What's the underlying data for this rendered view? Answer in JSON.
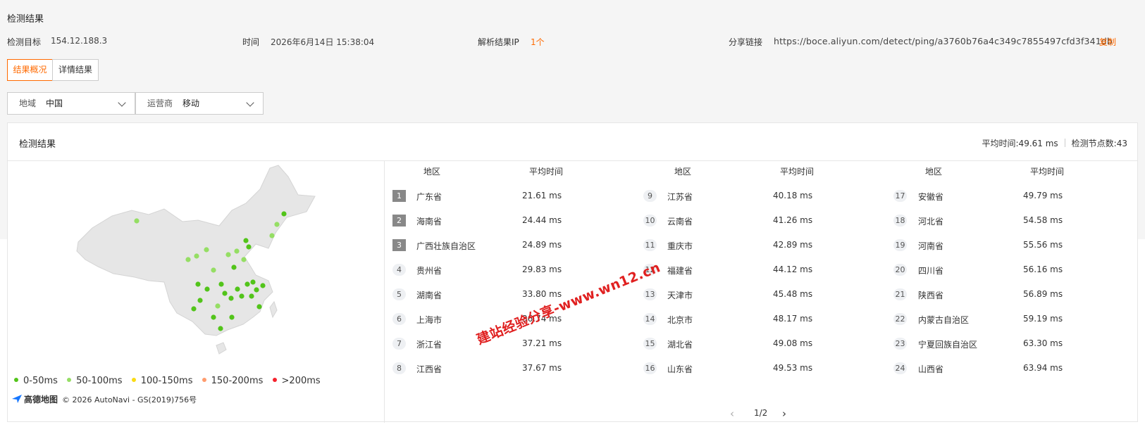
{
  "page": {
    "title": "检测结果"
  },
  "info": {
    "target_label": "检测目标",
    "target_value": "154.12.188.3",
    "time_label": "时间",
    "time_value": "2026年6月14日 15:38:04",
    "ip_label": "解析结果IP",
    "ip_value": "1个",
    "share_label": "分享链接",
    "share_value": "https://boce.aliyun.com/detect/ping/a3760b76a4c349c7855497cfd3f341db",
    "copy_label": "复制"
  },
  "tabs": [
    {
      "label": "结果概况",
      "active": true
    },
    {
      "label": "详情结果",
      "active": false
    }
  ],
  "filters": {
    "region": {
      "label": "地域",
      "value": "中国"
    },
    "isp": {
      "label": "运营商",
      "value": "移动"
    }
  },
  "panel": {
    "title": "检测结果",
    "avg_time": "平均时间:49.61 ms",
    "node_count": "检测节点数:43"
  },
  "legend": [
    {
      "label": "0-50ms",
      "color": "#52c41a"
    },
    {
      "label": "50-100ms",
      "color": "#95de64"
    },
    {
      "label": "100-150ms",
      "color": "#fadb14"
    },
    {
      "label": "150-200ms",
      "color": "#ff9c6e"
    },
    {
      "label": ">200ms",
      "color": "#f5222d"
    }
  ],
  "map_attribution": {
    "brand": "高德地图",
    "copyright": "© 2026 AutoNavi - GS(2019)756号"
  },
  "table": {
    "headers": {
      "region": "地区",
      "avg": "平均时间"
    },
    "rows": [
      {
        "rank": "1",
        "region": "广东省",
        "avg": "21.61 ms"
      },
      {
        "rank": "2",
        "region": "海南省",
        "avg": "24.44 ms"
      },
      {
        "rank": "3",
        "region": "广西壮族自治区",
        "avg": "24.89 ms"
      },
      {
        "rank": "4",
        "region": "贵州省",
        "avg": "29.83 ms"
      },
      {
        "rank": "5",
        "region": "湖南省",
        "avg": "33.80 ms"
      },
      {
        "rank": "6",
        "region": "上海市",
        "avg": "36.74 ms"
      },
      {
        "rank": "7",
        "region": "浙江省",
        "avg": "37.21 ms"
      },
      {
        "rank": "8",
        "region": "江西省",
        "avg": "37.67 ms"
      },
      {
        "rank": "9",
        "region": "江苏省",
        "avg": "40.18 ms"
      },
      {
        "rank": "10",
        "region": "云南省",
        "avg": "41.26 ms"
      },
      {
        "rank": "11",
        "region": "重庆市",
        "avg": "42.89 ms"
      },
      {
        "rank": "12",
        "region": "福建省",
        "avg": "44.12 ms"
      },
      {
        "rank": "13",
        "region": "天津市",
        "avg": "45.48 ms"
      },
      {
        "rank": "14",
        "region": "北京市",
        "avg": "48.17 ms"
      },
      {
        "rank": "15",
        "region": "湖北省",
        "avg": "49.08 ms"
      },
      {
        "rank": "16",
        "region": "山东省",
        "avg": "49.53 ms"
      },
      {
        "rank": "17",
        "region": "安徽省",
        "avg": "49.79 ms"
      },
      {
        "rank": "18",
        "region": "河北省",
        "avg": "54.58 ms"
      },
      {
        "rank": "19",
        "region": "河南省",
        "avg": "55.56 ms"
      },
      {
        "rank": "20",
        "region": "四川省",
        "avg": "56.16 ms"
      },
      {
        "rank": "21",
        "region": "陕西省",
        "avg": "56.89 ms"
      },
      {
        "rank": "22",
        "region": "内蒙古自治区",
        "avg": "59.19 ms"
      },
      {
        "rank": "23",
        "region": "宁夏回族自治区",
        "avg": "63.30 ms"
      },
      {
        "rank": "24",
        "region": "山西省",
        "avg": "63.94 ms"
      }
    ]
  },
  "pagination": {
    "current": "1/2"
  },
  "watermark": "建站经验分享-www.wn12.cn"
}
